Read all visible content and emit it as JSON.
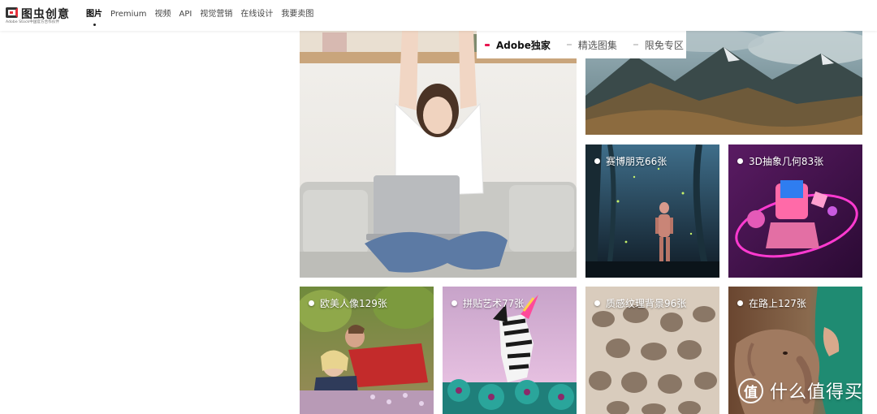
{
  "brand": {
    "logo_text": "图虫创意",
    "logo_subtext": "Adobe Stock中国官方合作伙伴"
  },
  "nav": {
    "items": [
      "图片",
      "Premium",
      "视频",
      "API",
      "视觉营销",
      "在线设计",
      "我要卖图"
    ],
    "active_index": 0
  },
  "tabs": {
    "items": [
      "Adobe独家",
      "精选图集",
      "限免专区"
    ],
    "active_index": 0,
    "active_color": "#e8154f"
  },
  "gallery": {
    "tiles": [
      {
        "label": ""
      },
      {
        "label": ""
      },
      {
        "label": "赛博朋克66张"
      },
      {
        "label": "3D抽象几何83张"
      },
      {
        "label": "欧美人像129张"
      },
      {
        "label": "拼贴艺术77张"
      },
      {
        "label": "质感纹理背景96张"
      },
      {
        "label": "在路上127张"
      }
    ]
  },
  "watermark": {
    "badge": "值",
    "text": "什么值得买"
  }
}
